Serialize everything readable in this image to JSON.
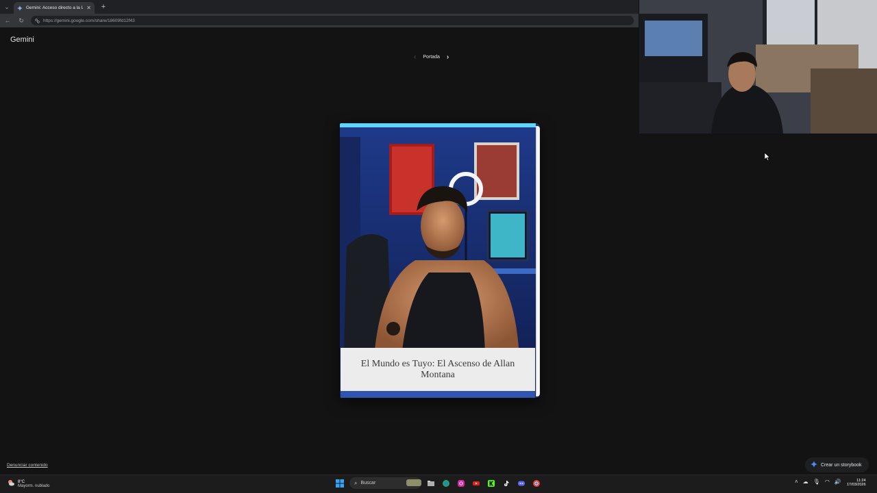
{
  "browser": {
    "tab_title": "Gemini: Acceso directo a la IA de",
    "url": "https://gemini.google.com/share/18609fd12f43"
  },
  "page": {
    "brand": "Gemini",
    "pager_label": "Portada",
    "book_title": "El Mundo es Tuyo: El Ascenso de Allan Montana",
    "report_link": "Denunciar contenido",
    "create_button": "Crear un storybook"
  },
  "taskbar": {
    "weather_temp": "8°C",
    "weather_desc": "Mayorm. nublado",
    "search_placeholder": "Buscar",
    "time": "11:24",
    "date": "17/03/2026"
  },
  "icons": {
    "back": "arrow-left-icon",
    "forward": "arrow-right-icon",
    "reload": "reload-icon",
    "pager_prev": "chevron-left-icon",
    "pager_next": "chevron-right-icon",
    "create": "sparkle-icon",
    "start": "windows-icon"
  },
  "colors": {
    "page_bg": "#131314",
    "chrome_bg": "#202124",
    "sparkle": "#4c8df6"
  }
}
